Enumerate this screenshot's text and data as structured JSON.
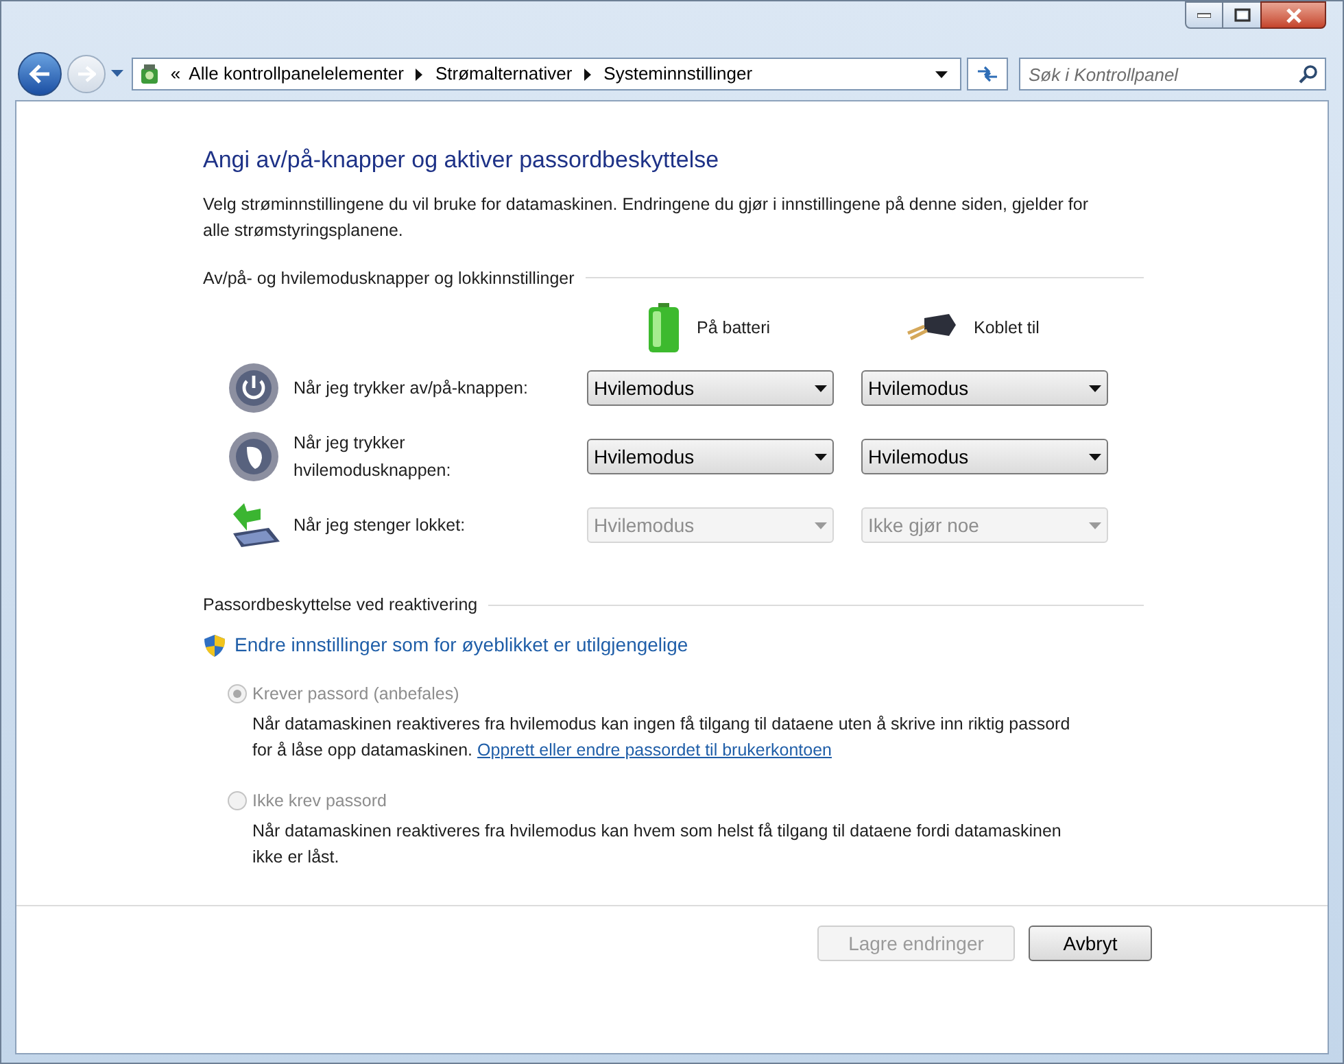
{
  "window": {
    "controls": [
      {
        "kind": "minimize"
      },
      {
        "kind": "maximize"
      },
      {
        "kind": "close"
      }
    ]
  },
  "navigation": {
    "back_disabled": false,
    "forward_disabled": true
  },
  "address_bar": {
    "overflow": "«",
    "crumbs": [
      "Alle kontrollpanelelementer",
      "Strømalternativer",
      "Systeminnstillinger"
    ]
  },
  "search": {
    "placeholder": "Søk i Kontrollpanel"
  },
  "heading": "Angi av/på-knapper og aktiver passordbeskyttelse",
  "description": "Velg strøminnstillingene du vil bruke for datamaskinen. Endringene du gjør i innstillingene på denne siden, gjelder for alle strømstyringsplanene.",
  "buttons_section": {
    "title": "Av/på- og hvilemodusknapper og lokkinnstillinger",
    "columns": [
      {
        "kind": "battery",
        "label": "På batteri"
      },
      {
        "kind": "plug",
        "label": "Koblet til"
      }
    ],
    "rows": [
      {
        "kind": "power",
        "label": "Når jeg trykker av/på-knappen:",
        "values": [
          {
            "value": "Hvilemodus",
            "disabled": false
          },
          {
            "value": "Hvilemodus",
            "disabled": false
          }
        ]
      },
      {
        "kind": "sleep",
        "label": "Når jeg trykker hvilemodusknappen:",
        "values": [
          {
            "value": "Hvilemodus",
            "disabled": false
          },
          {
            "value": "Hvilemodus",
            "disabled": false
          }
        ]
      },
      {
        "kind": "lid",
        "label": "Når jeg stenger lokket:",
        "values": [
          {
            "value": "Hvilemodus",
            "disabled": true
          },
          {
            "value": "Ikke gjør noe",
            "disabled": true
          }
        ]
      }
    ]
  },
  "password_section": {
    "title": "Passordbeskyttelse ved reaktivering",
    "admin_link": "Endre innstillinger som for øyeblikket er utilgjengelige",
    "options": [
      {
        "label": "Krever passord (anbefales)",
        "selected": true,
        "disabled": true,
        "description": "Når datamaskinen reaktiveres fra hvilemodus kan ingen få tilgang til dataene uten å skrive inn riktig passord for å låse opp datamaskinen.",
        "link": "Opprett eller endre passordet til brukerkontoen"
      },
      {
        "label": "Ikke krev passord",
        "selected": false,
        "disabled": true,
        "description": "Når datamaskinen reaktiveres fra hvilemodus kan hvem som helst få tilgang til dataene fordi datamaskinen ikke er låst."
      }
    ]
  },
  "buttons": [
    {
      "label": "Lagre endringer",
      "disabled": true
    },
    {
      "label": "Avbryt",
      "disabled": false
    }
  ]
}
